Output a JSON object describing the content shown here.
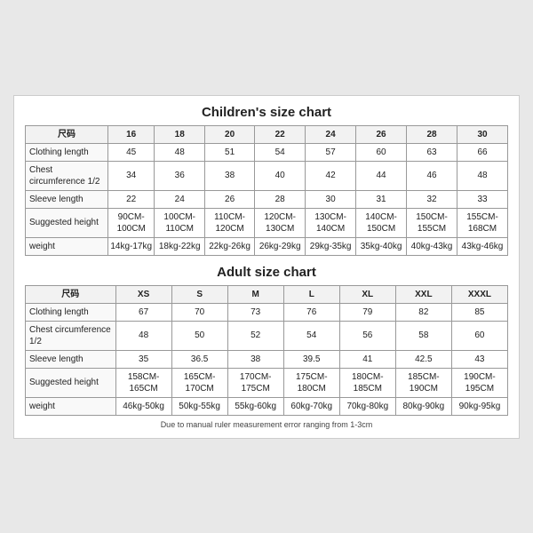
{
  "children_chart": {
    "title": "Children's size chart",
    "columns": [
      "尺码",
      "16",
      "18",
      "20",
      "22",
      "24",
      "26",
      "28",
      "30"
    ],
    "rows": [
      {
        "label": "Clothing length",
        "values": [
          "45",
          "48",
          "51",
          "54",
          "57",
          "60",
          "63",
          "66"
        ]
      },
      {
        "label": "Chest circumference 1/2",
        "values": [
          "34",
          "36",
          "38",
          "40",
          "42",
          "44",
          "46",
          "48"
        ]
      },
      {
        "label": "Sleeve length",
        "values": [
          "22",
          "24",
          "26",
          "28",
          "30",
          "31",
          "32",
          "33"
        ]
      },
      {
        "label": "Suggested height",
        "values": [
          "90CM-100CM",
          "100CM-110CM",
          "110CM-120CM",
          "120CM-130CM",
          "130CM-140CM",
          "140CM-150CM",
          "150CM-155CM",
          "155CM-168CM"
        ]
      },
      {
        "label": "weight",
        "values": [
          "14kg-17kg",
          "18kg-22kg",
          "22kg-26kg",
          "26kg-29kg",
          "29kg-35kg",
          "35kg-40kg",
          "40kg-43kg",
          "43kg-46kg"
        ]
      }
    ]
  },
  "adult_chart": {
    "title": "Adult size chart",
    "columns": [
      "尺码",
      "XS",
      "S",
      "M",
      "L",
      "XL",
      "XXL",
      "XXXL"
    ],
    "rows": [
      {
        "label": "Clothing length",
        "values": [
          "67",
          "70",
          "73",
          "76",
          "79",
          "82",
          "85"
        ]
      },
      {
        "label": "Chest circumference 1/2",
        "values": [
          "48",
          "50",
          "52",
          "54",
          "56",
          "58",
          "60"
        ]
      },
      {
        "label": "Sleeve length",
        "values": [
          "35",
          "36.5",
          "38",
          "39.5",
          "41",
          "42.5",
          "43"
        ]
      },
      {
        "label": "Suggested height",
        "values": [
          "158CM-165CM",
          "165CM-170CM",
          "170CM-175CM",
          "175CM-180CM",
          "180CM-185CM",
          "185CM-190CM",
          "190CM-195CM"
        ]
      },
      {
        "label": "weight",
        "values": [
          "46kg-50kg",
          "50kg-55kg",
          "55kg-60kg",
          "60kg-70kg",
          "70kg-80kg",
          "80kg-90kg",
          "90kg-95kg"
        ]
      }
    ]
  },
  "footer": {
    "note": "Due to manual ruler measurement error ranging from 1-3cm"
  }
}
